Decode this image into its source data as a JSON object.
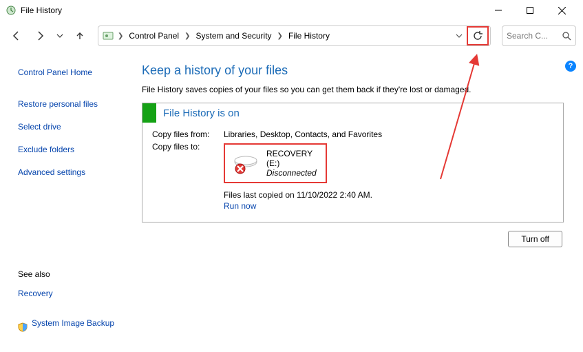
{
  "window": {
    "title": "File History"
  },
  "breadcrumbs": {
    "root_icon": "control-panel-icon",
    "items": [
      "Control Panel",
      "System and Security",
      "File History"
    ]
  },
  "search": {
    "placeholder": "Search C..."
  },
  "sidebar": {
    "home": "Control Panel Home",
    "links": [
      "Restore personal files",
      "Select drive",
      "Exclude folders",
      "Advanced settings"
    ],
    "see_also_label": "See also",
    "see_also_items": [
      "Recovery",
      "System Image Backup"
    ]
  },
  "main": {
    "heading": "Keep a history of your files",
    "description": "File History saves copies of your files so you can get them back if they're lost or damaged.",
    "panel_title": "File History is on",
    "copy_from_label": "Copy files from:",
    "copy_from_value": "Libraries, Desktop, Contacts, and Favorites",
    "copy_to_label": "Copy files to:",
    "drive_name": "RECOVERY (E:)",
    "drive_status": "Disconnected",
    "last_copied": "Files last copied on 11/10/2022 2:40 AM.",
    "run_now": "Run now",
    "turn_off": "Turn off"
  },
  "colors": {
    "accent_link": "#0645ad",
    "heading_blue": "#1b6bb7",
    "green": "#15a215",
    "highlight_red": "#e53935"
  }
}
